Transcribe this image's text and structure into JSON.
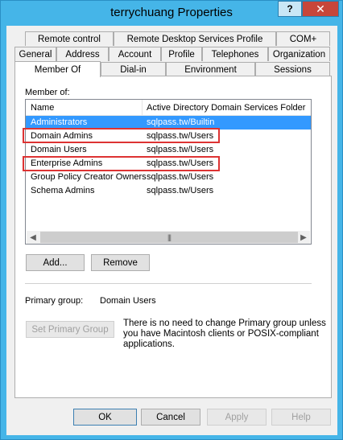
{
  "window": {
    "title": "terrychuang Properties",
    "help_label": "?",
    "close_label": "✕"
  },
  "tabs": {
    "row1": [
      "Remote control",
      "Remote Desktop Services Profile",
      "COM+"
    ],
    "row2": [
      "General",
      "Address",
      "Account",
      "Profile",
      "Telephones",
      "Organization"
    ],
    "row3": [
      "Member Of",
      "Dial-in",
      "Environment",
      "Sessions"
    ],
    "active": "Member Of"
  },
  "member_of": {
    "label": "Member of:",
    "columns": [
      "Name",
      "Active Directory Domain Services Folder"
    ],
    "rows": [
      {
        "name": "Administrators",
        "folder": "sqlpass.tw/Builtin",
        "selected": true
      },
      {
        "name": "Domain Admins",
        "folder": "sqlpass.tw/Users",
        "highlighted": true
      },
      {
        "name": "Domain Users",
        "folder": "sqlpass.tw/Users"
      },
      {
        "name": "Enterprise Admins",
        "folder": "sqlpass.tw/Users",
        "highlighted": true
      },
      {
        "name": "Group Policy Creator Owners",
        "folder": "sqlpass.tw/Users"
      },
      {
        "name": "Schema Admins",
        "folder": "sqlpass.tw/Users"
      }
    ],
    "add_label": "Add...",
    "remove_label": "Remove"
  },
  "primary_group": {
    "label": "Primary group:",
    "value": "Domain Users",
    "set_button_label": "Set Primary Group",
    "note_lines": [
      "There is no need to change Primary group unless",
      "you have Macintosh clients or POSIX-compliant",
      "applications."
    ]
  },
  "footer": {
    "ok_label": "OK",
    "cancel_label": "Cancel",
    "apply_label": "Apply",
    "help_label": "Help"
  },
  "colors": {
    "titlebar": "#45b5e8",
    "close": "#c7463a",
    "selection": "#3399ff",
    "highlight_box": "#dd3333"
  },
  "icons": {
    "scroll_left": "◀",
    "scroll_right": "▶",
    "scroll_grip": "|||"
  }
}
